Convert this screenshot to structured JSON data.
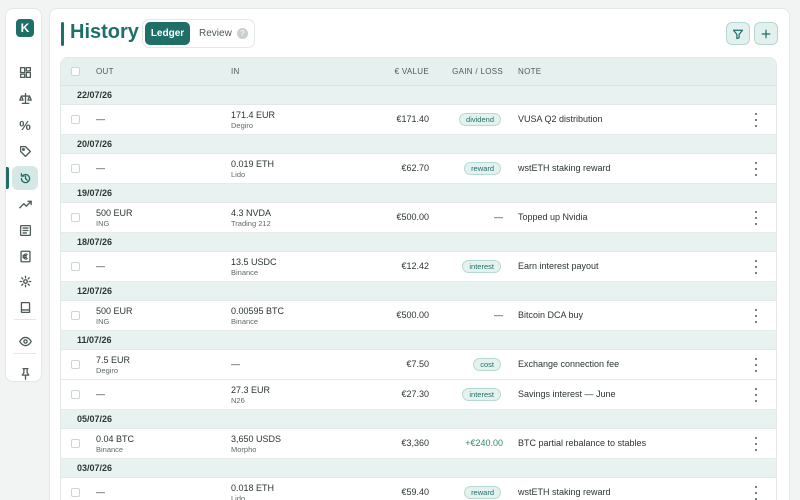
{
  "app": {
    "logo_letter": "K"
  },
  "sidebar": {
    "items": [
      {
        "name": "dashboard-icon"
      },
      {
        "name": "scale-icon"
      },
      {
        "name": "percent-icon",
        "glyph": "%"
      },
      {
        "name": "tag-icon"
      },
      {
        "name": "history-icon",
        "active": true
      },
      {
        "name": "trending-up-icon"
      },
      {
        "name": "newspaper-icon"
      },
      {
        "name": "euro-icon"
      },
      {
        "name": "gear-icon"
      },
      {
        "name": "book-icon"
      },
      {
        "name": "eye-icon"
      },
      {
        "name": "pin-icon"
      }
    ]
  },
  "header": {
    "title": "History",
    "tabs": {
      "ledger": "Ledger",
      "review": "Review",
      "help": "?"
    }
  },
  "table": {
    "headers": {
      "out": "OUT",
      "in": "IN",
      "value": "€ VALUE",
      "gain": "GAIN / LOSS",
      "note": "NOTE"
    },
    "groups": [
      {
        "date": "22/07/26",
        "rows": [
          {
            "out_amount": "—",
            "out_source": "",
            "in_amount": "171.4 EUR",
            "in_source": "Degiro",
            "value": "€171.40",
            "gain": "",
            "badge": "dividend",
            "note": "VUSA Q2 distribution"
          }
        ]
      },
      {
        "date": "20/07/26",
        "rows": [
          {
            "out_amount": "—",
            "out_source": "",
            "in_amount": "0.019 ETH",
            "in_source": "Lido",
            "value": "€62.70",
            "gain": "",
            "badge": "reward",
            "note": "wstETH staking reward"
          }
        ]
      },
      {
        "date": "19/07/26",
        "rows": [
          {
            "out_amount": "500 EUR",
            "out_source": "ING",
            "in_amount": "4.3 NVDA",
            "in_source": "Trading 212",
            "value": "€500.00",
            "gain": "—",
            "badge": "",
            "note": "Topped up Nvidia"
          }
        ]
      },
      {
        "date": "18/07/26",
        "rows": [
          {
            "out_amount": "—",
            "out_source": "",
            "in_amount": "13.5 USDC",
            "in_source": "Binance",
            "value": "€12.42",
            "gain": "",
            "badge": "interest",
            "note": "Earn interest payout"
          }
        ]
      },
      {
        "date": "12/07/26",
        "rows": [
          {
            "out_amount": "500 EUR",
            "out_source": "ING",
            "in_amount": "0.00595 BTC",
            "in_source": "Binance",
            "value": "€500.00",
            "gain": "—",
            "badge": "",
            "note": "Bitcoin DCA buy"
          }
        ]
      },
      {
        "date": "11/07/26",
        "rows": [
          {
            "out_amount": "7.5 EUR",
            "out_source": "Degiro",
            "in_amount": "—",
            "in_source": "",
            "value": "€7.50",
            "gain": "",
            "badge": "cost",
            "note": "Exchange connection fee"
          },
          {
            "out_amount": "—",
            "out_source": "",
            "in_amount": "27.3 EUR",
            "in_source": "N26",
            "value": "€27.30",
            "gain": "",
            "badge": "interest",
            "note": "Savings interest — June"
          }
        ]
      },
      {
        "date": "05/07/26",
        "rows": [
          {
            "out_amount": "0.04 BTC",
            "out_source": "Binance",
            "in_amount": "3,650 USDS",
            "in_source": "Morpho",
            "value": "€3,360",
            "gain": "+€240.00",
            "gain_positive": true,
            "badge": "",
            "note": "BTC partial rebalance to stables"
          }
        ]
      },
      {
        "date": "03/07/26",
        "rows": [
          {
            "out_amount": "—",
            "out_source": "",
            "in_amount": "0.018 ETH",
            "in_source": "Lido",
            "value": "€59.40",
            "gain": "",
            "badge": "reward",
            "note": "wstETH staking reward"
          }
        ]
      }
    ]
  }
}
